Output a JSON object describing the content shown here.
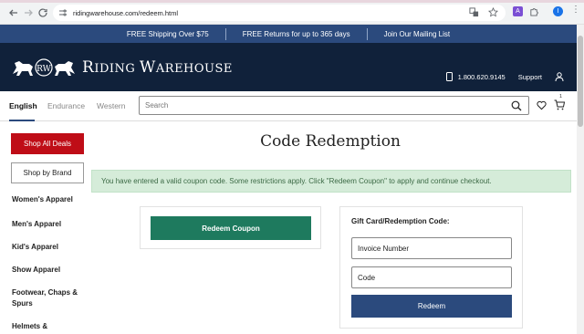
{
  "browser": {
    "url": "ridingwarehouse.com/redeem.html",
    "profile_initial": "I"
  },
  "promo": {
    "items": [
      "FREE Shipping Over $75",
      "FREE Returns for up to 365 days",
      "Join Our Mailing List"
    ]
  },
  "header": {
    "logo_monogram": "RW",
    "logo_text_first": "R",
    "logo_text_rest1": "IDING ",
    "logo_text_second": "W",
    "logo_text_rest2": "AREHOUSE",
    "phone": "1.800.620.9145",
    "support": "Support"
  },
  "nav": {
    "disciplines": [
      "English",
      "Endurance",
      "Western"
    ],
    "active": "English",
    "search_placeholder": "Search",
    "cart_count": "1"
  },
  "sidebar": {
    "deals_button": "Shop All Deals",
    "brand_button": "Shop by Brand",
    "categories": [
      "Women's Apparel",
      "Men's Apparel",
      "Kid's Apparel",
      "Show Apparel",
      "Footwear, Chaps & Spurs",
      "Helmets &"
    ]
  },
  "main": {
    "title": "Code Redemption",
    "alert": "You have entered a valid coupon code. Some restrictions apply. Click \"Redeem Coupon\" to apply and continue checkout.",
    "redeem_coupon_button": "Redeem Coupon",
    "gift_label": "Gift Card/Redemption Code:",
    "invoice_placeholder": "Invoice Number",
    "code_placeholder": "Code",
    "redeem_button": "Redeem"
  },
  "colors": {
    "promo_bg": "#2b4a7d",
    "header_bg": "#10213a",
    "deals_red": "#bf0d17",
    "coupon_green": "#1e7a5e",
    "alert_bg": "#d5ecd9"
  }
}
